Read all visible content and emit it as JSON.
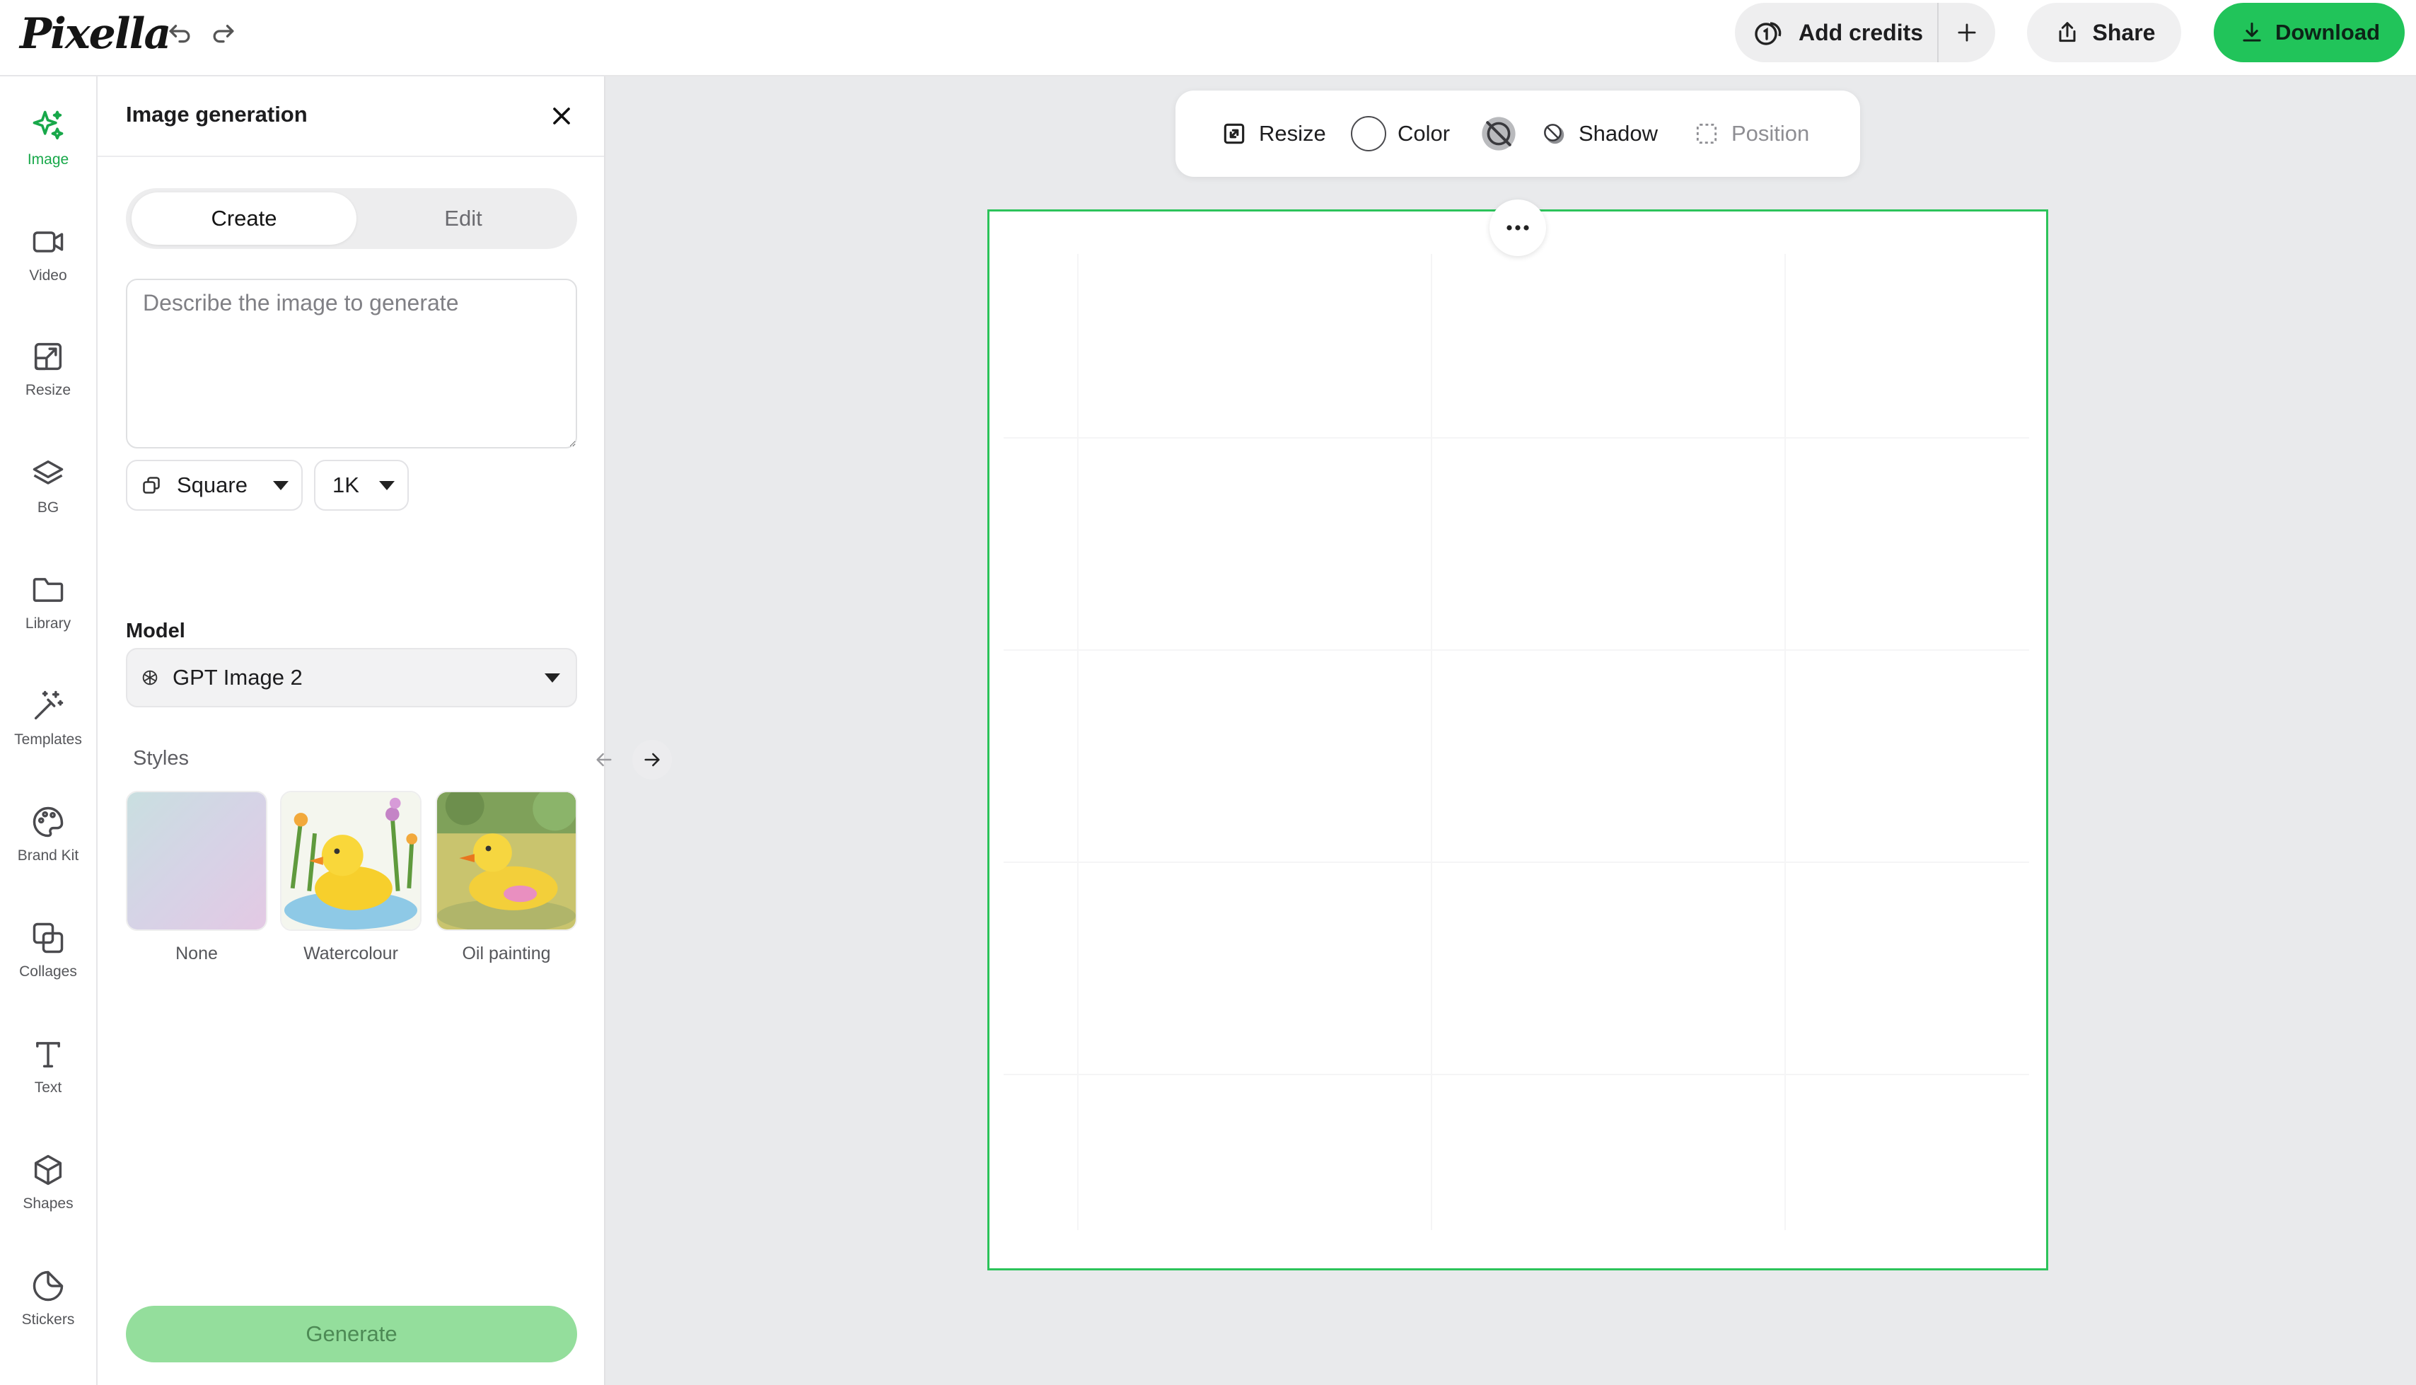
{
  "app": {
    "name": "Pixella"
  },
  "header": {
    "add_credits_label": "Add credits",
    "share_label": "Share",
    "download_label": "Download"
  },
  "nav": {
    "items": [
      {
        "label": "Image",
        "icon": "sparkle-icon"
      },
      {
        "label": "Video",
        "icon": "video-icon"
      },
      {
        "label": "Resize",
        "icon": "resize-icon"
      },
      {
        "label": "BG",
        "icon": "layers-icon"
      },
      {
        "label": "Library",
        "icon": "folder-icon"
      },
      {
        "label": "Templates",
        "icon": "magic-wand-icon"
      },
      {
        "label": "Brand Kit",
        "icon": "palette-icon"
      },
      {
        "label": "Collages",
        "icon": "collage-icon"
      },
      {
        "label": "Text",
        "icon": "text-icon"
      },
      {
        "label": "Shapes",
        "icon": "cube-icon"
      },
      {
        "label": "Stickers",
        "icon": "sticker-icon"
      }
    ],
    "active": "Image"
  },
  "panel": {
    "title": "Image generation",
    "tabs": {
      "create": "Create",
      "edit": "Edit",
      "selected": "Create"
    },
    "prompt_placeholder": "Describe the image to generate",
    "prompt_value": "",
    "aspect": "Square",
    "resolution": "1K",
    "model_label": "Model",
    "model": "GPT Image 2",
    "styles_label": "Styles",
    "styles": [
      {
        "name": "None"
      },
      {
        "name": "Watercolour"
      },
      {
        "name": "Oil painting"
      }
    ],
    "generate_label": "Generate"
  },
  "toolbar": {
    "resize_label": "Resize",
    "color_label": "Color",
    "shadow_label": "Shadow",
    "position_label": "Position"
  },
  "colors": {
    "accent": "#21c45a",
    "canvas_border": "#2cc35a",
    "generate_disabled": "#94de9c",
    "nav_active": "#18a84a"
  }
}
